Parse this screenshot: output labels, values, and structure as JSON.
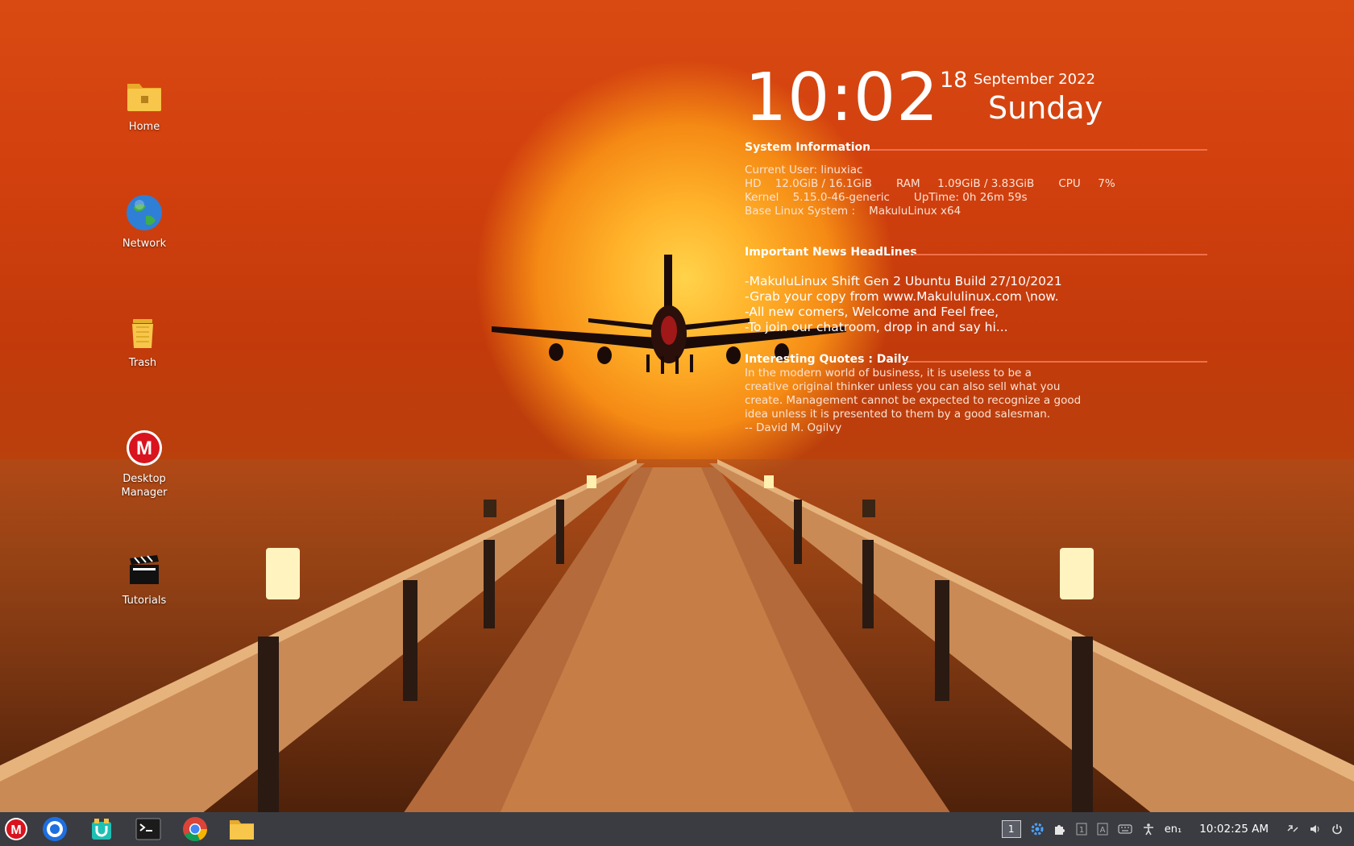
{
  "desktop": {
    "icons": [
      {
        "label": "Home",
        "icon": "folder-home-icon"
      },
      {
        "label": "Network",
        "icon": "globe-icon"
      },
      {
        "label": "Trash",
        "icon": "trash-icon"
      },
      {
        "label": "Desktop Manager",
        "icon": "makulu-logo-icon"
      },
      {
        "label": "Tutorials",
        "icon": "clapperboard-icon"
      }
    ]
  },
  "conky": {
    "time": "10:02",
    "day": "18",
    "month_year": "September 2022",
    "weekday": "Sunday",
    "system_title": "System Information",
    "current_user": "Current User: linuxiac",
    "hd_line": "HD    12.0GiB / 16.1GiB       RAM     1.09GiB / 3.83GiB       CPU     7%",
    "kernel_line": "Kernel    5.15.0-46-generic       UpTime: 0h 26m 59s",
    "base_line": "Base Linux System :    MakuluLinux x64",
    "news_title": "Important News HeadLines",
    "news": [
      "-MakuluLinux Shift Gen 2 Ubuntu Build 27/10/2021",
      "-Grab your copy from www.Makululinux.com \\now.",
      "-All new comers, Welcome and Feel free,",
      "-To join our chatroom, drop in and say hi..."
    ],
    "quotes_title": "Interesting Quotes : Daily",
    "quote_lines": [
      "In the modern world of business, it is useless to be a",
      "creative original thinker unless you can also sell what you",
      "create. Management cannot be expected to recognize a good",
      "idea unless it is presented to them by a good salesman.",
      "-- David M. Ogilvy"
    ]
  },
  "taskbar": {
    "apps": [
      "makulu-menu-icon",
      "launcher-circle-icon",
      "software-store-icon",
      "terminal-icon",
      "chrome-icon",
      "files-icon"
    ],
    "workspace": "1",
    "keyboard_layout": "en₁",
    "clock": "10:02:25 AM",
    "tray_icons": [
      "settings-gear-icon",
      "extensions-puzzle-icon",
      "input-method-1-icon",
      "input-method-a-icon",
      "keyboard-icon",
      "accessibility-icon",
      "network-icon",
      "volume-icon",
      "power-icon"
    ]
  },
  "colors": {
    "accent_rule": "#f0704a",
    "taskbar": "#3a3c42"
  }
}
